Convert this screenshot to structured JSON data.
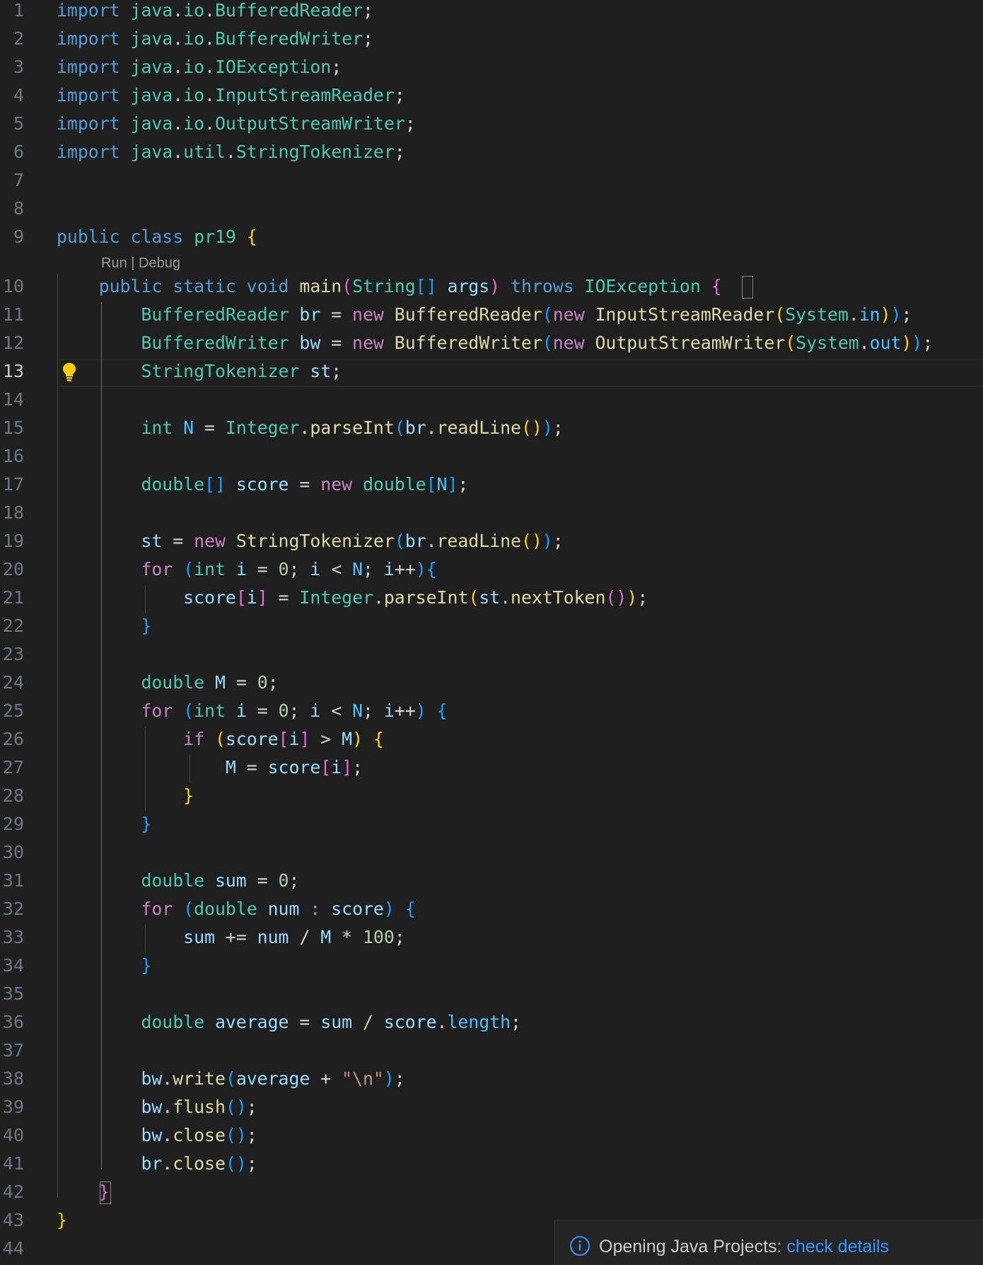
{
  "editor": {
    "active_line": "13",
    "line_numbers": [
      "1",
      "2",
      "3",
      "4",
      "5",
      "6",
      "7",
      "8",
      "9",
      "10",
      "11",
      "12",
      "13",
      "14",
      "15",
      "16",
      "17",
      "18",
      "19",
      "20",
      "21",
      "22",
      "23",
      "24",
      "25",
      "26",
      "27",
      "28",
      "29",
      "30",
      "31",
      "32",
      "33",
      "34",
      "35",
      "36",
      "37",
      "38",
      "39",
      "40",
      "41",
      "42",
      "43",
      "44"
    ],
    "codelens": {
      "run": "Run",
      "separator": " | ",
      "debug": "Debug"
    },
    "lines": [
      [
        [
          "import",
          "kw"
        ],
        [
          " ",
          ""
        ],
        [
          "java",
          "type"
        ],
        [
          ".",
          "op"
        ],
        [
          "io",
          "type"
        ],
        [
          ".",
          "op"
        ],
        [
          "BufferedReader",
          "type"
        ],
        [
          ";",
          "op"
        ]
      ],
      [
        [
          "import",
          "kw"
        ],
        [
          " ",
          ""
        ],
        [
          "java",
          "type"
        ],
        [
          ".",
          "op"
        ],
        [
          "io",
          "type"
        ],
        [
          ".",
          "op"
        ],
        [
          "BufferedWriter",
          "type"
        ],
        [
          ";",
          "op"
        ]
      ],
      [
        [
          "import",
          "kw"
        ],
        [
          " ",
          ""
        ],
        [
          "java",
          "type"
        ],
        [
          ".",
          "op"
        ],
        [
          "io",
          "type"
        ],
        [
          ".",
          "op"
        ],
        [
          "IOException",
          "type"
        ],
        [
          ";",
          "op"
        ]
      ],
      [
        [
          "import",
          "kw"
        ],
        [
          " ",
          ""
        ],
        [
          "java",
          "type"
        ],
        [
          ".",
          "op"
        ],
        [
          "io",
          "type"
        ],
        [
          ".",
          "op"
        ],
        [
          "InputStreamReader",
          "type"
        ],
        [
          ";",
          "op"
        ]
      ],
      [
        [
          "import",
          "kw"
        ],
        [
          " ",
          ""
        ],
        [
          "java",
          "type"
        ],
        [
          ".",
          "op"
        ],
        [
          "io",
          "type"
        ],
        [
          ".",
          "op"
        ],
        [
          "OutputStreamWriter",
          "type"
        ],
        [
          ";",
          "op"
        ]
      ],
      [
        [
          "import",
          "kw"
        ],
        [
          " ",
          ""
        ],
        [
          "java",
          "type"
        ],
        [
          ".",
          "op"
        ],
        [
          "util",
          "type"
        ],
        [
          ".",
          "op"
        ],
        [
          "StringTokenizer",
          "type"
        ],
        [
          ";",
          "op"
        ]
      ],
      [],
      [],
      [
        [
          "public",
          "kw"
        ],
        [
          " ",
          ""
        ],
        [
          "class",
          "kw"
        ],
        [
          " ",
          ""
        ],
        [
          "pr19",
          "type"
        ],
        [
          " ",
          ""
        ],
        [
          "{",
          "br1"
        ]
      ],
      [
        [
          "    ",
          ""
        ],
        [
          "public",
          "kw"
        ],
        [
          " ",
          ""
        ],
        [
          "static",
          "kw"
        ],
        [
          " ",
          ""
        ],
        [
          "void",
          "kw"
        ],
        [
          " ",
          ""
        ],
        [
          "main",
          "fn"
        ],
        [
          "(",
          "br2"
        ],
        [
          "String",
          "type"
        ],
        [
          "[]",
          "br3"
        ],
        [
          " ",
          ""
        ],
        [
          "args",
          "var"
        ],
        [
          ")",
          "br2"
        ],
        [
          " ",
          ""
        ],
        [
          "throws",
          "kw"
        ],
        [
          " ",
          ""
        ],
        [
          "IOException",
          "type"
        ],
        [
          " ",
          ""
        ],
        [
          "{",
          "br2"
        ]
      ],
      [
        [
          "        ",
          ""
        ],
        [
          "BufferedReader",
          "type"
        ],
        [
          " ",
          ""
        ],
        [
          "br",
          "var"
        ],
        [
          " = ",
          "op"
        ],
        [
          "new",
          "ctl"
        ],
        [
          " ",
          ""
        ],
        [
          "BufferedReader",
          "fn"
        ],
        [
          "(",
          "br3"
        ],
        [
          "new",
          "ctl"
        ],
        [
          " ",
          ""
        ],
        [
          "InputStreamReader",
          "fn"
        ],
        [
          "(",
          "br1"
        ],
        [
          "System",
          "type"
        ],
        [
          ".",
          "op"
        ],
        [
          "in",
          "const"
        ],
        [
          ")",
          "br1"
        ],
        [
          ")",
          "br3"
        ],
        [
          ";",
          "op"
        ]
      ],
      [
        [
          "        ",
          ""
        ],
        [
          "BufferedWriter",
          "type"
        ],
        [
          " ",
          ""
        ],
        [
          "bw",
          "var"
        ],
        [
          " = ",
          "op"
        ],
        [
          "new",
          "ctl"
        ],
        [
          " ",
          ""
        ],
        [
          "BufferedWriter",
          "fn"
        ],
        [
          "(",
          "br3"
        ],
        [
          "new",
          "ctl"
        ],
        [
          " ",
          ""
        ],
        [
          "OutputStreamWriter",
          "fn"
        ],
        [
          "(",
          "br1"
        ],
        [
          "System",
          "type"
        ],
        [
          ".",
          "op"
        ],
        [
          "out",
          "const"
        ],
        [
          ")",
          "br1"
        ],
        [
          ")",
          "br3"
        ],
        [
          ";",
          "op"
        ]
      ],
      [
        [
          "        ",
          ""
        ],
        [
          "StringTokenizer",
          "type"
        ],
        [
          " ",
          ""
        ],
        [
          "st",
          "var"
        ],
        [
          ";",
          "op"
        ]
      ],
      [],
      [
        [
          "        ",
          ""
        ],
        [
          "int",
          "type"
        ],
        [
          " ",
          ""
        ],
        [
          "N",
          "const"
        ],
        [
          " = ",
          "op"
        ],
        [
          "Integer",
          "type"
        ],
        [
          ".",
          "op"
        ],
        [
          "parseInt",
          "fn"
        ],
        [
          "(",
          "br3"
        ],
        [
          "br",
          "var"
        ],
        [
          ".",
          "op"
        ],
        [
          "readLine",
          "fn"
        ],
        [
          "()",
          "br1"
        ],
        [
          ")",
          "br3"
        ],
        [
          ";",
          "op"
        ]
      ],
      [],
      [
        [
          "        ",
          ""
        ],
        [
          "double",
          "type"
        ],
        [
          "[]",
          "br3"
        ],
        [
          " ",
          ""
        ],
        [
          "score",
          "var"
        ],
        [
          " = ",
          "op"
        ],
        [
          "new",
          "ctl"
        ],
        [
          " ",
          ""
        ],
        [
          "double",
          "type"
        ],
        [
          "[",
          "br3"
        ],
        [
          "N",
          "const"
        ],
        [
          "]",
          "br3"
        ],
        [
          ";",
          "op"
        ]
      ],
      [],
      [
        [
          "        ",
          ""
        ],
        [
          "st",
          "var"
        ],
        [
          " = ",
          "op"
        ],
        [
          "new",
          "ctl"
        ],
        [
          " ",
          ""
        ],
        [
          "StringTokenizer",
          "fn"
        ],
        [
          "(",
          "br3"
        ],
        [
          "br",
          "var"
        ],
        [
          ".",
          "op"
        ],
        [
          "readLine",
          "fn"
        ],
        [
          "()",
          "br1"
        ],
        [
          ")",
          "br3"
        ],
        [
          ";",
          "op"
        ]
      ],
      [
        [
          "        ",
          ""
        ],
        [
          "for",
          "ctl"
        ],
        [
          " ",
          ""
        ],
        [
          "(",
          "br3"
        ],
        [
          "int",
          "type"
        ],
        [
          " ",
          ""
        ],
        [
          "i",
          "var"
        ],
        [
          " = ",
          "op"
        ],
        [
          "0",
          "num"
        ],
        [
          "; ",
          "op"
        ],
        [
          "i",
          "var"
        ],
        [
          " < ",
          "op"
        ],
        [
          "N",
          "const"
        ],
        [
          "; ",
          "op"
        ],
        [
          "i",
          "var"
        ],
        [
          "++",
          "op"
        ],
        [
          ")",
          "br3"
        ],
        [
          "{",
          "br3"
        ]
      ],
      [
        [
          "            ",
          ""
        ],
        [
          "score",
          "var"
        ],
        [
          "[",
          "br2"
        ],
        [
          "i",
          "var"
        ],
        [
          "]",
          "br2"
        ],
        [
          " = ",
          "op"
        ],
        [
          "Integer",
          "type"
        ],
        [
          ".",
          "op"
        ],
        [
          "parseInt",
          "fn"
        ],
        [
          "(",
          "br1"
        ],
        [
          "st",
          "var"
        ],
        [
          ".",
          "op"
        ],
        [
          "nextToken",
          "fn"
        ],
        [
          "()",
          "br2"
        ],
        [
          ")",
          "br1"
        ],
        [
          ";",
          "op"
        ]
      ],
      [
        [
          "        ",
          ""
        ],
        [
          "}",
          "br3"
        ]
      ],
      [],
      [
        [
          "        ",
          ""
        ],
        [
          "double",
          "type"
        ],
        [
          " ",
          ""
        ],
        [
          "M",
          "var"
        ],
        [
          " = ",
          "op"
        ],
        [
          "0",
          "num"
        ],
        [
          ";",
          "op"
        ]
      ],
      [
        [
          "        ",
          ""
        ],
        [
          "for",
          "ctl"
        ],
        [
          " ",
          ""
        ],
        [
          "(",
          "br3"
        ],
        [
          "int",
          "type"
        ],
        [
          " ",
          ""
        ],
        [
          "i",
          "var"
        ],
        [
          " = ",
          "op"
        ],
        [
          "0",
          "num"
        ],
        [
          "; ",
          "op"
        ],
        [
          "i",
          "var"
        ],
        [
          " < ",
          "op"
        ],
        [
          "N",
          "const"
        ],
        [
          "; ",
          "op"
        ],
        [
          "i",
          "var"
        ],
        [
          "++",
          "op"
        ],
        [
          ")",
          "br3"
        ],
        [
          " ",
          ""
        ],
        [
          "{",
          "br3"
        ]
      ],
      [
        [
          "            ",
          ""
        ],
        [
          "if",
          "ctl"
        ],
        [
          " ",
          ""
        ],
        [
          "(",
          "br1"
        ],
        [
          "score",
          "var"
        ],
        [
          "[",
          "br2"
        ],
        [
          "i",
          "var"
        ],
        [
          "]",
          "br2"
        ],
        [
          " > ",
          "op"
        ],
        [
          "M",
          "var"
        ],
        [
          ")",
          "br1"
        ],
        [
          " ",
          ""
        ],
        [
          "{",
          "br1"
        ]
      ],
      [
        [
          "                ",
          ""
        ],
        [
          "M",
          "var"
        ],
        [
          " = ",
          "op"
        ],
        [
          "score",
          "var"
        ],
        [
          "[",
          "br2"
        ],
        [
          "i",
          "var"
        ],
        [
          "]",
          "br2"
        ],
        [
          ";",
          "op"
        ]
      ],
      [
        [
          "            ",
          ""
        ],
        [
          "}",
          "br1"
        ]
      ],
      [
        [
          "        ",
          ""
        ],
        [
          "}",
          "br3"
        ]
      ],
      [],
      [
        [
          "        ",
          ""
        ],
        [
          "double",
          "type"
        ],
        [
          " ",
          ""
        ],
        [
          "sum",
          "var"
        ],
        [
          " = ",
          "op"
        ],
        [
          "0",
          "num"
        ],
        [
          ";",
          "op"
        ]
      ],
      [
        [
          "        ",
          ""
        ],
        [
          "for",
          "ctl"
        ],
        [
          " ",
          ""
        ],
        [
          "(",
          "br3"
        ],
        [
          "double",
          "type"
        ],
        [
          " ",
          ""
        ],
        [
          "num",
          "var"
        ],
        [
          " : ",
          "ctl"
        ],
        [
          "score",
          "var"
        ],
        [
          ")",
          "br3"
        ],
        [
          " ",
          ""
        ],
        [
          "{",
          "br3"
        ]
      ],
      [
        [
          "            ",
          ""
        ],
        [
          "sum",
          "var"
        ],
        [
          " += ",
          "op"
        ],
        [
          "num",
          "var"
        ],
        [
          " / ",
          "op"
        ],
        [
          "M",
          "var"
        ],
        [
          " * ",
          "op"
        ],
        [
          "100",
          "num"
        ],
        [
          ";",
          "op"
        ]
      ],
      [
        [
          "        ",
          ""
        ],
        [
          "}",
          "br3"
        ]
      ],
      [],
      [
        [
          "        ",
          ""
        ],
        [
          "double",
          "type"
        ],
        [
          " ",
          ""
        ],
        [
          "average",
          "var"
        ],
        [
          " = ",
          "op"
        ],
        [
          "sum",
          "var"
        ],
        [
          " / ",
          "op"
        ],
        [
          "score",
          "var"
        ],
        [
          ".",
          "op"
        ],
        [
          "length",
          "const"
        ],
        [
          ";",
          "op"
        ]
      ],
      [],
      [
        [
          "        ",
          ""
        ],
        [
          "bw",
          "var"
        ],
        [
          ".",
          "op"
        ],
        [
          "write",
          "fn"
        ],
        [
          "(",
          "br3"
        ],
        [
          "average",
          "var"
        ],
        [
          " + ",
          "op"
        ],
        [
          "\"\\n\"",
          "str"
        ],
        [
          ")",
          "br3"
        ],
        [
          ";",
          "op"
        ]
      ],
      [
        [
          "        ",
          ""
        ],
        [
          "bw",
          "var"
        ],
        [
          ".",
          "op"
        ],
        [
          "flush",
          "fn"
        ],
        [
          "()",
          "br3"
        ],
        [
          ";",
          "op"
        ]
      ],
      [
        [
          "        ",
          ""
        ],
        [
          "bw",
          "var"
        ],
        [
          ".",
          "op"
        ],
        [
          "close",
          "fn"
        ],
        [
          "()",
          "br3"
        ],
        [
          ";",
          "op"
        ]
      ],
      [
        [
          "        ",
          ""
        ],
        [
          "br",
          "var"
        ],
        [
          ".",
          "op"
        ],
        [
          "close",
          "fn"
        ],
        [
          "()",
          "br3"
        ],
        [
          ";",
          "op"
        ]
      ],
      [
        [
          "    ",
          ""
        ],
        [
          "}",
          "br2"
        ]
      ],
      [
        [
          "}",
          "br1"
        ]
      ],
      []
    ]
  },
  "notification": {
    "message": "Opening Java Projects: ",
    "link": "check details",
    "icon": "info-icon"
  },
  "colors": {
    "background": "#1f1f1f",
    "keyword": "#569cd6",
    "control": "#c586c0",
    "type": "#4ec9b0",
    "variable": "#9cdcfe",
    "function": "#dcdcaa",
    "number": "#b5cea8",
    "string": "#ce9178",
    "link": "#3794ff"
  }
}
